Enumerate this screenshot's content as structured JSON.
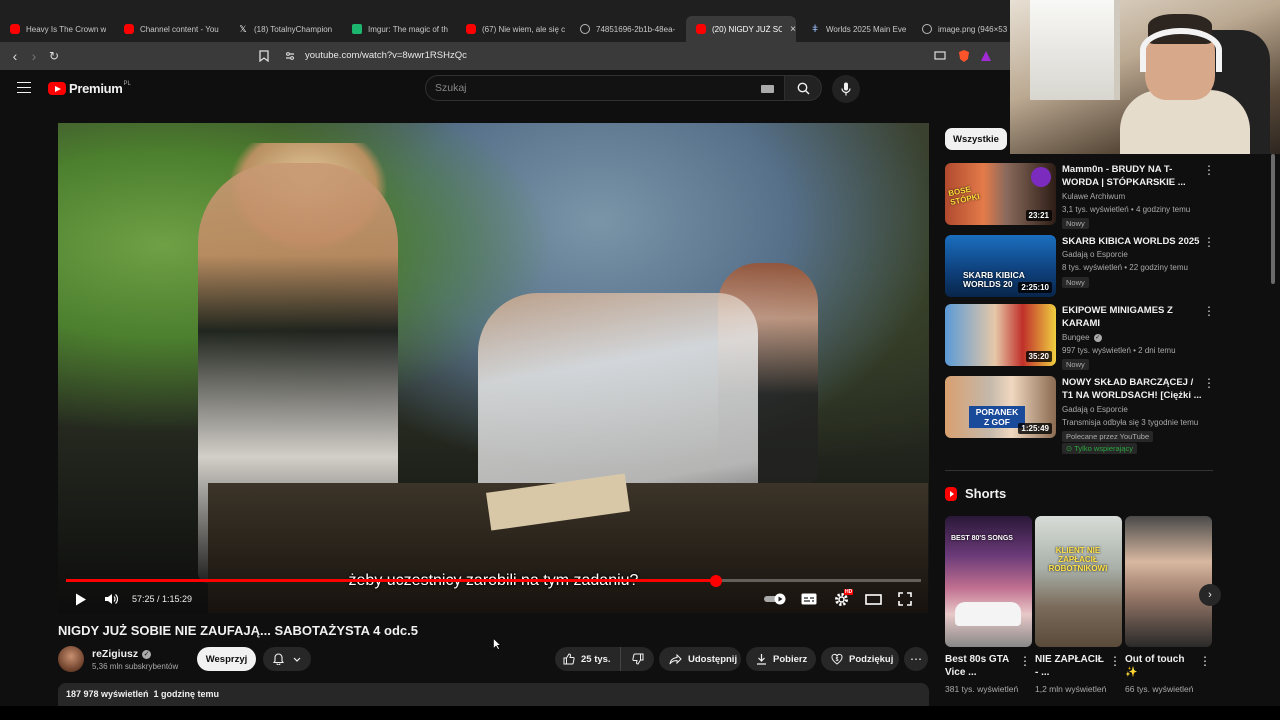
{
  "browser": {
    "tabs": [
      {
        "label": "Heavy Is The Crown w",
        "icon": "youtube-icon"
      },
      {
        "label": "Channel content - You",
        "icon": "youtube-icon"
      },
      {
        "label": "(18) TotalnyChampion",
        "icon": "x-icon"
      },
      {
        "label": "Imgur: The magic of th",
        "icon": "imgur-icon"
      },
      {
        "label": "(67) Nie wiem, ale się c",
        "icon": "youtube-icon"
      },
      {
        "label": "74851696-2b1b-48ea-",
        "icon": "globe-icon"
      },
      {
        "label": "(20) NIGDY JUŻ SO",
        "icon": "youtube-icon",
        "active": true
      },
      {
        "label": "Worlds 2025 Main Eve",
        "icon": "tp-icon"
      },
      {
        "label": "image.png (946×53",
        "icon": "globe-icon"
      }
    ],
    "tab_close": "×",
    "url": "youtube.com/watch?v=8wwr1RSHzQc",
    "nav": {
      "back": "‹",
      "forward": "›",
      "reload": "↻"
    }
  },
  "header": {
    "logo_text": "Premium",
    "region": "PL",
    "search_placeholder": "Szukaj"
  },
  "player": {
    "subtitle": "żeby uczestnicy zarobili na tym zadaniu?",
    "current_time": "57:25",
    "duration": "1:15:29",
    "time_display": "57:25 / 1:15:29",
    "progress_fraction": 0.76,
    "quality_badge": "HD"
  },
  "video": {
    "title": "NIGDY JUŻ SOBIE NIE ZAUFAJĄ... SABOTAŻYSTA 4 odc.5",
    "channel": "reZigiusz",
    "subscribers": "5,36 mln subskrybentów",
    "support_label": "Wesprzyj",
    "likes": "25 tys.",
    "share_label": "Udostępnij",
    "download_label": "Pobierz",
    "thanks_label": "Podziękuj",
    "views_time": "187 978 wyświetleń  1 godzinę temu"
  },
  "sidebar": {
    "chip": "Wszystkie",
    "recommendations": [
      {
        "title": "Mamm0n - BRUDY NA T-WORDA | STÓPKARSKIE ...",
        "channel": "Kulawe Archiwum",
        "meta": "3,1 tys. wyświetleń • 4 godziny temu",
        "badge": "Nowy",
        "duration": "23:21",
        "thumb_text": "BOSE STÓPKI"
      },
      {
        "title": "SKARB KIBICA WORLDS 2025",
        "channel": "Gadają o Esporcie",
        "meta": "8 tys. wyświetleń • 22 godziny temu",
        "badge": "Nowy",
        "duration": "2:25:10",
        "thumb_text": "SKARB KIBICA WORLDS 20"
      },
      {
        "title": "EKIPOWE MINIGAMES Z KARAMI",
        "channel": "Bungee",
        "meta": "997 tys. wyświetleń • 2 dni temu",
        "badge": "Nowy",
        "duration": "35:20",
        "thumb_text": ""
      },
      {
        "title": "NOWY SKŁAD BARCZĄCEJ / T1 NA WORLDSACH! [Ciężki ...",
        "channel": "Gadają o Esporcie",
        "meta": "Transmisja odbyła się 3 tygodnie temu",
        "badge": "Polecane przez YouTube",
        "member": "Tylko wspierający",
        "duration": "1:25:49",
        "thumb_text": "PORANEK Z GOF"
      }
    ],
    "shorts_title": "Shorts",
    "shorts": [
      {
        "title": "Best 80s GTA Vice ...",
        "views": "381 tys. wyświetleń",
        "thumb_text": "BEST 80'S SONGS"
      },
      {
        "title": "NIE ZAPŁACIŁ - ...",
        "views": "1,2 mln wyświetleń",
        "thumb_text": "KLIENT NIE ZAPŁACIŁ ROBOTNIKOWI"
      },
      {
        "title": "Out of touch ✨",
        "views": "66 tys. wyświetleń",
        "thumb_text": ""
      }
    ]
  },
  "colors": {
    "background": "#0f0f0f",
    "brand_red": "#ff0000",
    "chip_bg": "#f1f1f1",
    "pill_bg": "#272727",
    "secondary_text": "#aaaaaa",
    "member_green": "#2ba640"
  }
}
